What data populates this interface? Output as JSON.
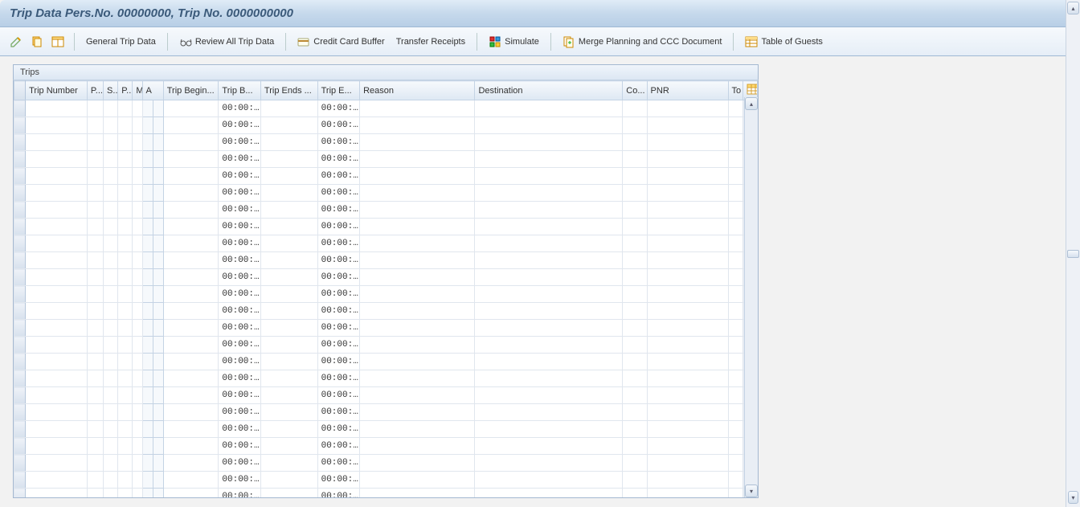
{
  "title": "Trip Data Pers.No. 00000000, Trip No. 0000000000",
  "toolbar": {
    "general_trip_data": "General Trip Data",
    "review_all": "Review All Trip Data",
    "credit_card_buffer": "Credit Card Buffer",
    "transfer_receipts": "Transfer Receipts",
    "simulate": "Simulate",
    "merge_planning": "Merge Planning and CCC Document",
    "table_of_guests": "Table of Guests"
  },
  "table": {
    "title": "Trips",
    "columns": {
      "trip_number": "Trip Number",
      "p1": "P...",
      "s": "S..",
      "p2": "P..",
      "m": "M",
      "a": "A",
      "trip_begins": "Trip Begin...",
      "trip_b": "Trip B...",
      "trip_ends": "Trip Ends ...",
      "trip_e": "Trip E...",
      "reason": "Reason",
      "destination": "Destination",
      "co": "Co...",
      "pnr": "PNR",
      "to": "To"
    },
    "default_time": "00:00:…",
    "row_count": 24
  }
}
